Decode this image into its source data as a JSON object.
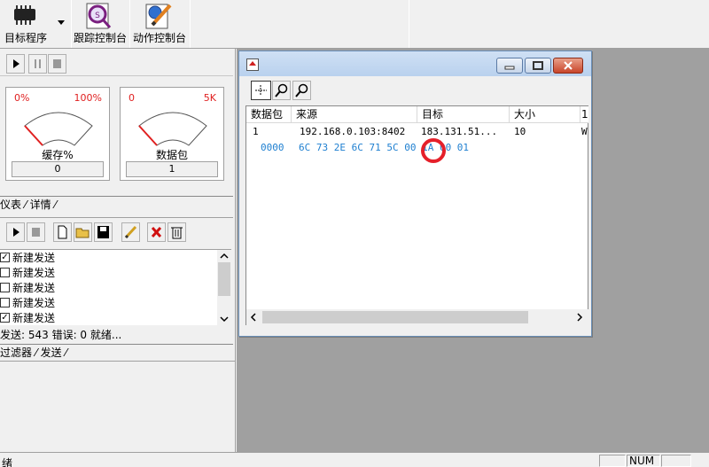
{
  "toolbar": {
    "target_program_label": "目标程序",
    "trace_console_label": "跟踪控制台",
    "action_console_label": "动作控制台"
  },
  "gauges": {
    "cache": {
      "min": "0%",
      "max": "100%",
      "label": "缓存%",
      "value": "0"
    },
    "packets": {
      "min": "0",
      "max": "5K",
      "label": "数据包",
      "value": "1"
    }
  },
  "gauge_tabs": {
    "text": "仪表 ⁄ 详情 ⁄"
  },
  "send_list": {
    "items": [
      {
        "label": "新建发送",
        "checked": true
      },
      {
        "label": "新建发送",
        "checked": false
      },
      {
        "label": "新建发送",
        "checked": false
      },
      {
        "label": "新建发送",
        "checked": false
      },
      {
        "label": "新建发送",
        "checked": true
      }
    ],
    "status": "发送: 543  错误:  0  就绪..."
  },
  "bottom_tabs": {
    "text": "过滤器 ⁄ 发送 ⁄"
  },
  "packet_window": {
    "columns": [
      "数据包",
      "来源",
      "目标",
      "大小",
      "1"
    ],
    "rows": [
      {
        "num": "1",
        "src": "192.168.0.103:8402",
        "dst": "183.131.51...",
        "size": "10",
        "extra": "W"
      }
    ],
    "hex_offset": "0000",
    "hex_bytes": "6C 73 2E 6C 71 5C 00 1A 00 01"
  },
  "status_bar": {
    "left_text": "绪",
    "num_text": "NUM"
  },
  "colors": {
    "gauge_range": "#e02020",
    "hex_text": "#1e7fd0",
    "highlight_circle": "#e5202a",
    "workspace": "#a0a0a0"
  }
}
